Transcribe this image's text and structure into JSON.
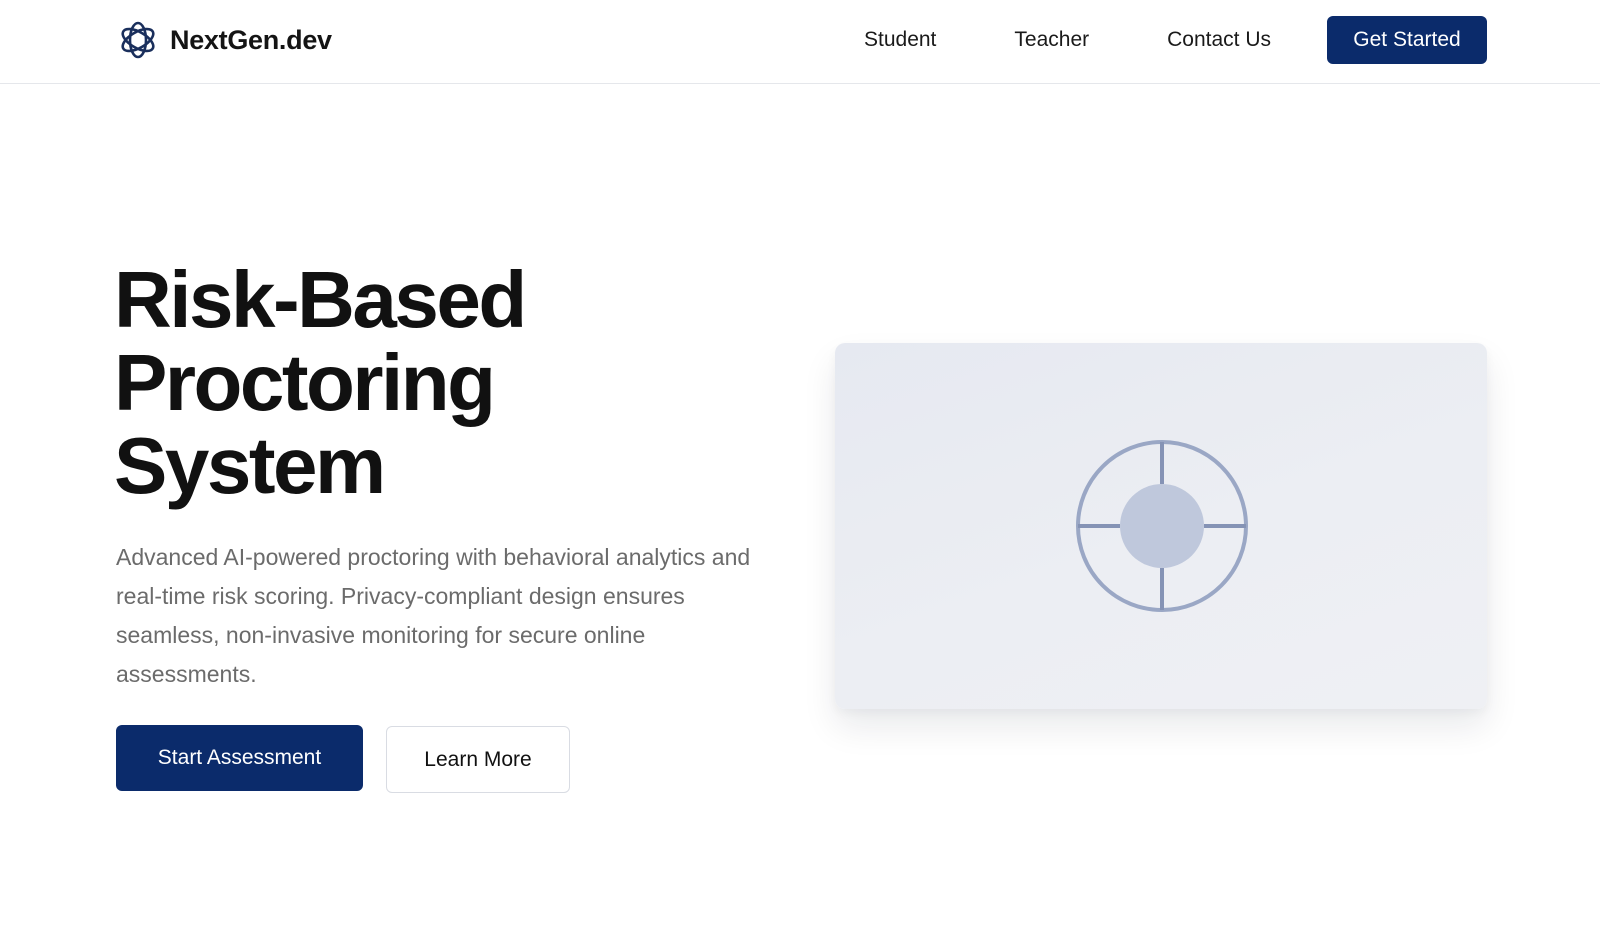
{
  "nav": {
    "brand": "NextGen.dev",
    "links": [
      "Student",
      "Teacher",
      "Contact Us"
    ],
    "cta": "Get Started"
  },
  "hero": {
    "title_lines": [
      "Risk-Based",
      "Proctoring",
      "System"
    ],
    "description": "Advanced AI-powered proctoring with behavioral analytics and real-time risk scoring. Privacy-compliant design ensures seamless, non-invasive monitoring for secure online assessments.",
    "primary_button": "Start Assessment",
    "secondary_button": "Learn More",
    "illustration_icon": "crosshair-target-icon"
  },
  "colors": {
    "brand_navy": "#0b2b6b",
    "text_dark": "#111111",
    "text_muted": "#6b6b6b",
    "card_bg": "#e9ecf2",
    "icon_stroke": "#9aa7c5",
    "icon_fill": "#bfc8dc"
  }
}
